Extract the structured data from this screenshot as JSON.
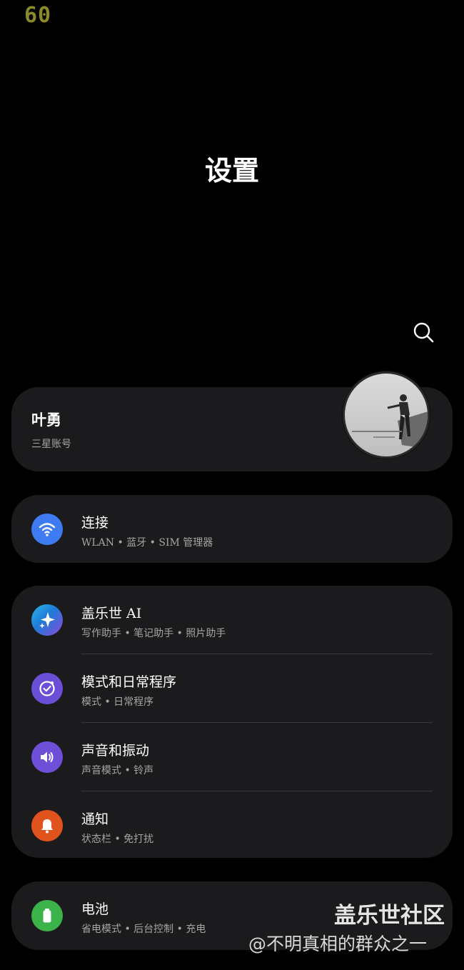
{
  "status": {
    "fps": "60"
  },
  "header": {
    "title": "设置"
  },
  "account": {
    "name": "叶勇",
    "subtitle": "三星账号"
  },
  "settings": {
    "connections": {
      "label": "连接",
      "subtitle": "WLAN • 蓝牙 • SIM 管理器",
      "icon": "wifi-icon",
      "color": "#3e7bf0"
    },
    "galaxy_ai": {
      "label": "盖乐世 AI",
      "subtitle": "写作助手 • 笔记助手 • 照片助手",
      "icon": "sparkle-icon",
      "color": "#2aa4d8"
    },
    "modes": {
      "label": "模式和日常程序",
      "subtitle": "模式 • 日常程序",
      "icon": "check-circle-icon",
      "color": "#6a4fd6"
    },
    "sounds": {
      "label": "声音和振动",
      "subtitle": "声音模式 • 铃声",
      "icon": "speaker-icon",
      "color": "#6d4fd8"
    },
    "notifications": {
      "label": "通知",
      "subtitle": "状态栏 • 免打扰",
      "icon": "bell-icon",
      "color": "#e0531f"
    },
    "battery": {
      "label": "电池",
      "subtitle": "省电模式 • 后台控制 • 充电",
      "icon": "battery-icon",
      "color": "#3bb24a"
    }
  },
  "watermark": {
    "line1": "盖乐世社区",
    "line2": "@不明真相的群众之一"
  }
}
